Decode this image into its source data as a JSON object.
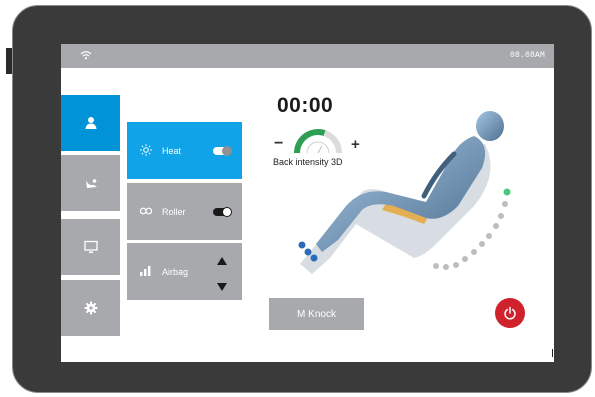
{
  "status_bar": {
    "time": "08.08AM",
    "wifi_icon": "wifi-icon"
  },
  "sidebar": {
    "items": [
      {
        "name": "user",
        "icon": "user-icon",
        "active": true
      },
      {
        "name": "massage-mode",
        "icon": "massage-icon",
        "active": false
      },
      {
        "name": "display",
        "icon": "monitor-icon",
        "active": false
      },
      {
        "name": "settings",
        "icon": "gear-icon",
        "active": false
      }
    ]
  },
  "functions": {
    "heat": {
      "label": "Heat",
      "icon": "sun-icon",
      "on": true
    },
    "roller": {
      "label": "Roller",
      "icon": "infinity-icon",
      "on": true
    },
    "airbag": {
      "label": "Airbag",
      "icon": "signal-bars-icon"
    }
  },
  "timer": {
    "value": "00:00"
  },
  "intensity": {
    "label": "Back intensity 3D",
    "minus": "−",
    "plus": "+",
    "level_fraction": 0.6
  },
  "buttons": {
    "knock_label": "M Knock",
    "power_icon": "power-icon"
  },
  "colors": {
    "accent": "#0093d7",
    "tile_gray": "#a7a9ac",
    "power_red": "#d0222c",
    "gauge_green": "#2e9e52",
    "bezel": "#3a3a3b"
  }
}
